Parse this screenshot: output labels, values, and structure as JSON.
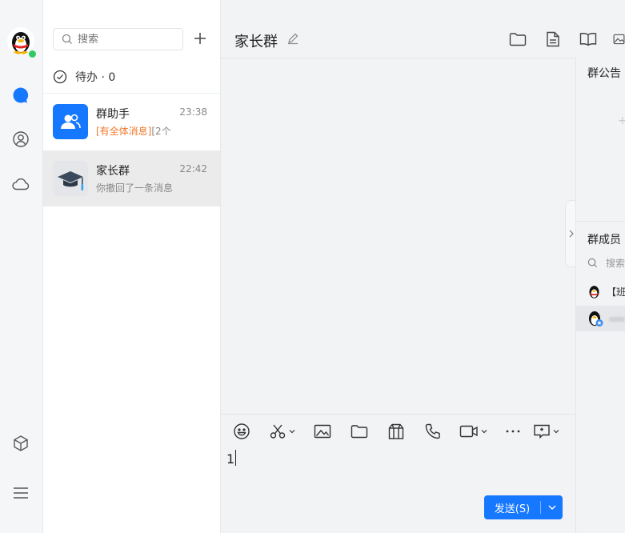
{
  "colors": {
    "accent": "#1677ff",
    "online": "#2ecb63",
    "mention_tag": "#f0782a"
  },
  "rail": {
    "avatar_icon": "qq-penguin-avatar",
    "nav": [
      "chat-bubble-icon",
      "contacts-icon",
      "cloud-icon"
    ],
    "bottom": [
      "apps-cube-icon",
      "menu-icon"
    ]
  },
  "list": {
    "search_placeholder": "搜索",
    "todo_label": "待办 · 0",
    "conversations": [
      {
        "name": "群助手",
        "time": "23:38",
        "tag": "[有全体消息]",
        "preview": "[2个",
        "avatar_icon": "group-assistant-icon"
      },
      {
        "name": "家长群",
        "time": "22:42",
        "tag": "",
        "preview": "你撤回了一条消息",
        "avatar_icon": "graduation-cap-icon"
      }
    ]
  },
  "chat": {
    "title": "家长群",
    "header_icons": [
      "folder-icon",
      "document-icon",
      "book-icon",
      "image-icon"
    ],
    "toolbar_icons": [
      "emoji-icon",
      "scissors-icon",
      "picture-icon",
      "folder-icon",
      "gift-icon",
      "phone-icon",
      "video-icon",
      "more-icon",
      "screen-share-icon"
    ],
    "composer_text": "1",
    "send_label": "发送(S)"
  },
  "side_panel": {
    "announcement_title": "群公告",
    "members_title": "群成员",
    "search_placeholder": "搜索",
    "members": [
      {
        "name": "【班",
        "avatar_icon": "qq-penguin-avatar"
      },
      {
        "name": "",
        "avatar_icon": "qq-penguin-avatar-admin"
      }
    ]
  }
}
